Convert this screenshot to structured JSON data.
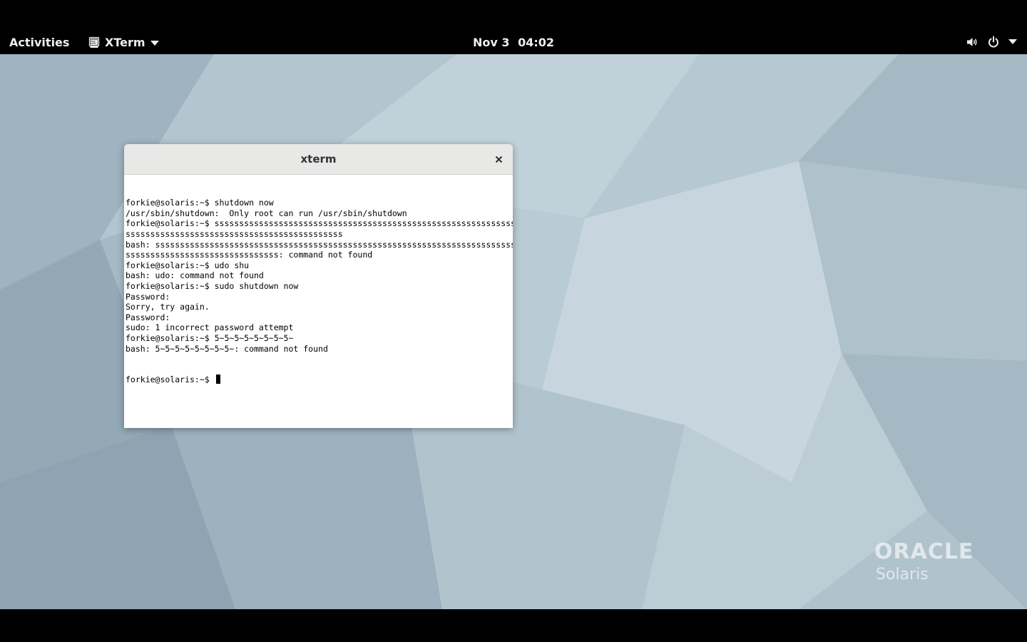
{
  "topbar": {
    "activities_label": "Activities",
    "app_menu_label": "XTerm",
    "clock_date": "Nov 3",
    "clock_time": "04:02"
  },
  "icons": {
    "app": "terminal-icon",
    "app_caret": "caret-down-icon",
    "volume": "volume-icon",
    "power": "power-icon",
    "status_caret": "caret-down-icon",
    "close": "close-icon"
  },
  "window": {
    "title": "xterm",
    "terminal_lines": [
      "forkie@solaris:~$ shutdown now",
      "/usr/sbin/shutdown:  Only root can run /usr/sbin/shutdown",
      "forkie@solaris:~$ sssssssssssssssssssssssssssssssssssssssssssssssssssssssssssssssss",
      "ssssssssssssssssssssssssssssssssssssssssssss",
      "bash: ssssssssssssssssssssssssssssssssssssssssssssssssssssssssssssssssssssssssss",
      "sssssssssssssssssssssssssssssss: command not found",
      "forkie@solaris:~$ udo shu",
      "bash: udo: command not found",
      "forkie@solaris:~$ sudo shutdown now",
      "Password:",
      "Sorry, try again.",
      "Password:",
      "sudo: 1 incorrect password attempt",
      "forkie@solaris:~$ 5~5~5~5~5~5~5~5~",
      "bash: 5~5~5~5~5~5~5~5~: command not found"
    ],
    "prompt": "forkie@solaris:~$ "
  },
  "desktop": {
    "brand_logo": "ORACLE",
    "brand_product": "Solaris"
  },
  "colors": {
    "topbar_bg": "#000000",
    "topbar_text": "#eeeeec",
    "titlebar_bg": "#e8e8e7",
    "terminal_bg": "#ffffff",
    "terminal_fg": "#000000",
    "wallpaper_base": "#a9bdc8"
  }
}
